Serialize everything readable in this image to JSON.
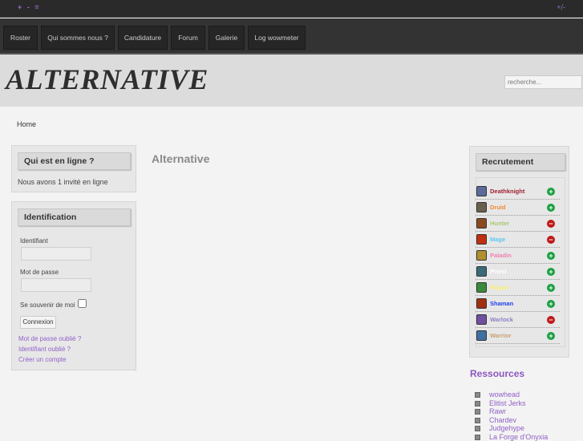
{
  "topbar": {
    "font_controls": "+ - =",
    "toggle": "+/-"
  },
  "nav": [
    "Roster",
    "Qui sommes nous ?",
    "Candidature",
    "Forum",
    "Galerie",
    "Log wowmeter"
  ],
  "header": {
    "logo": "ALTERNATIVE",
    "search_placeholder": "recherche..."
  },
  "breadcrumb": "Home",
  "online": {
    "title": "Qui est en ligne ?",
    "text": "Nous avons 1 invité en ligne"
  },
  "login": {
    "title": "Identification",
    "username_label": "Identifiant",
    "password_label": "Mot de passe",
    "remember_label": "Se souvenir de moi",
    "submit": "Connexion",
    "links": [
      "Mot de passe oublié ?",
      "Identifiant oublié ?",
      "Créer un compte"
    ]
  },
  "content": {
    "title": "Alternative"
  },
  "recruit": {
    "title": "Recrutement",
    "classes": [
      {
        "name": "Deathknight",
        "color": "#a02030",
        "open": true,
        "icon": "#5a6a9a"
      },
      {
        "name": "Druid",
        "color": "#f08a30",
        "open": true,
        "icon": "#6a6050"
      },
      {
        "name": "Hunter",
        "color": "#a8c870",
        "open": false,
        "icon": "#8a4a20"
      },
      {
        "name": "Mage",
        "color": "#60c8f0",
        "open": false,
        "icon": "#c03010"
      },
      {
        "name": "Paladin",
        "color": "#f080b0",
        "open": true,
        "icon": "#b09030"
      },
      {
        "name": "Priest",
        "color": "#ffffff",
        "open": true,
        "icon": "#3a6a7a"
      },
      {
        "name": "Rogue",
        "color": "#f8f070",
        "open": true,
        "icon": "#3a8a3a"
      },
      {
        "name": "Shaman",
        "color": "#2040f0",
        "open": true,
        "icon": "#a03010"
      },
      {
        "name": "Warlock",
        "color": "#9080c8",
        "open": false,
        "icon": "#7050a0"
      },
      {
        "name": "Warrior",
        "color": "#c8a070",
        "open": true,
        "icon": "#4070a0"
      }
    ]
  },
  "resources": {
    "title": "Ressources",
    "items": [
      "wowhead",
      "Elitist Jerks",
      "Rawr",
      "Chardev",
      "Judgehype",
      "La Forge d'Onyxia"
    ]
  }
}
